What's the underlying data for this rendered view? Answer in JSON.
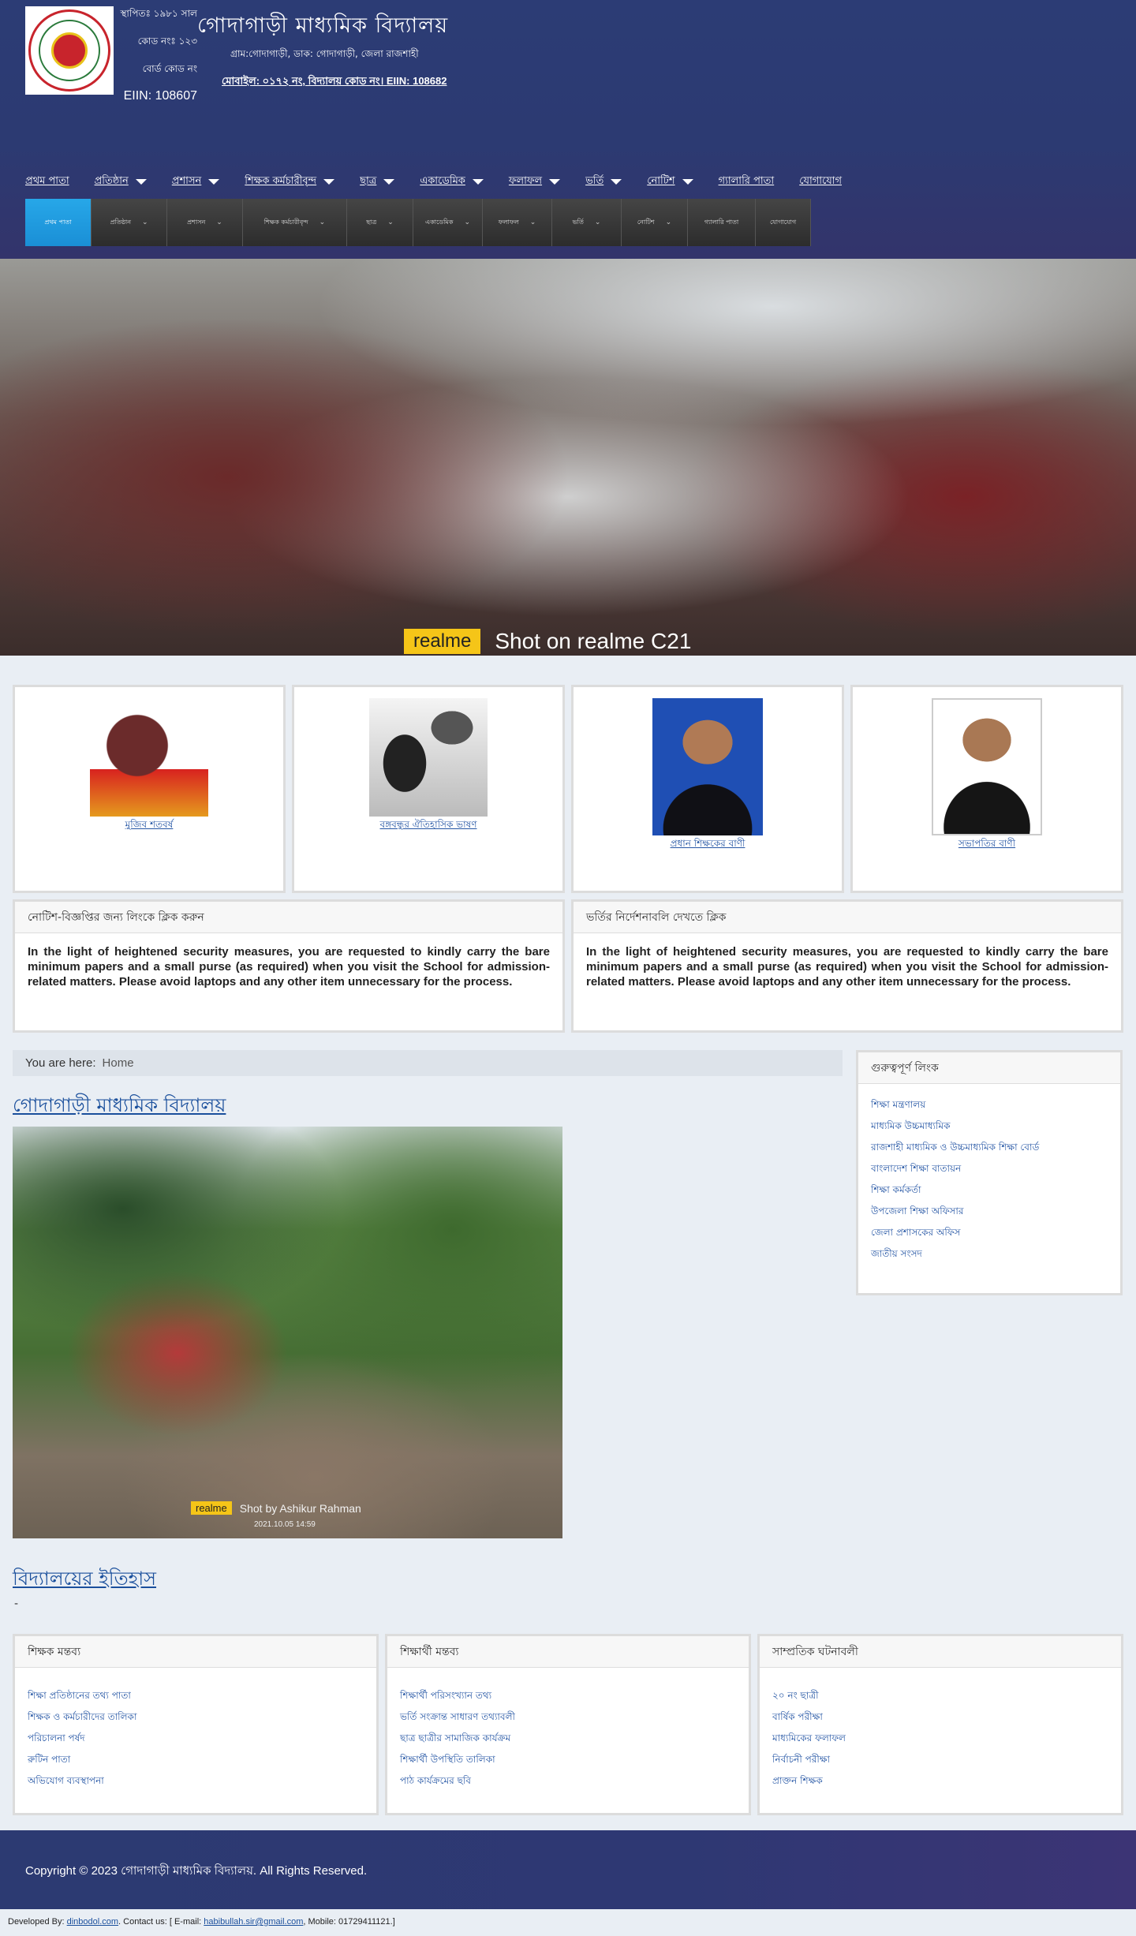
{
  "header": {
    "meta_lines": [
      "স্থাপিতঃ ১৯৮১ সাল",
      "কোড নংঃ ১২৩",
      "বোর্ড কোড নং"
    ],
    "eiin_short": "EIIN: 108607",
    "title": "গোদাগাড়ী মাধ্যমিক বিদ্যালয়",
    "address": "গ্রাম:গোদাগাড়ী, ডাক: গোদাগাড়ী, জেলা রাজশাহী",
    "contact": "মোবাইল: ০১৭২ নং, বিদ্যালয় কোড নং।",
    "contact_eiin": "EIIN: 108682"
  },
  "topnav": [
    {
      "label": "প্রথম পাতা",
      "caret": false,
      "active": true
    },
    {
      "label": "প্রতিষ্ঠান",
      "caret": true
    },
    {
      "label": "প্রশাসন",
      "caret": true
    },
    {
      "label": "শিক্ষক কর্মচারীবৃন্দ",
      "caret": true
    },
    {
      "label": "ছাত্র",
      "caret": true
    },
    {
      "label": "একাডেমিক",
      "caret": true
    },
    {
      "label": "ফলাফল",
      "caret": true
    },
    {
      "label": "ভর্তি",
      "caret": true
    },
    {
      "label": "নোটিশ",
      "caret": true
    },
    {
      "label": "গ্যালারি পাতা",
      "caret": false
    },
    {
      "label": "যোগাযোগ",
      "caret": false
    }
  ],
  "subnav": [
    {
      "label": "প্রথম পাতা",
      "chev": false,
      "active": true
    },
    {
      "label": "প্রতিষ্ঠান",
      "chev": true
    },
    {
      "label": "প্রশাসন",
      "chev": true
    },
    {
      "label": "শিক্ষক কর্মচারীবৃন্দ",
      "chev": true
    },
    {
      "label": "ছাত্র",
      "chev": true
    },
    {
      "label": "একাডেমিক",
      "chev": true
    },
    {
      "label": "ফলাফল",
      "chev": true
    },
    {
      "label": "ভর্তি",
      "chev": true
    },
    {
      "label": "নোটিশ",
      "chev": true
    },
    {
      "label": "গ্যালারি পাতা",
      "chev": false
    },
    {
      "label": "যোগাযোগ",
      "chev": false
    }
  ],
  "hero": {
    "watermark_badge": "realme",
    "watermark_text": "Shot on realme C21"
  },
  "cards": [
    {
      "caption": "মুজিব শতবর্ষ",
      "kind": "bb"
    },
    {
      "caption": "বঙ্গবন্ধুর ঐতিহাসিক ভাষণ",
      "kind": "bw"
    },
    {
      "caption": "প্রধান শিক্ষকের বাণী",
      "kind": "p1"
    },
    {
      "caption": "সভাপতির বাণী",
      "kind": "p2"
    }
  ],
  "notices": [
    {
      "title": "নোটিশ-বিজ্ঞপ্তির জন্য লিংকে ক্লিক করুন",
      "body": "In the light of heightened security measures, you are requested to kindly carry the bare minimum papers and a small purse (as required) when you visit the School for admission- related matters. Please avoid laptops and any other item unnecessary for the process."
    },
    {
      "title": "ভর্তির নির্দেশনাবলি দেখতে ক্লিক",
      "body": "In the light of heightened security measures, you are requested to kindly carry the bare minimum papers and a small purse (as required) when you visit the School for admission- related matters. Please avoid laptops and any other item unnecessary for the process."
    }
  ],
  "breadcrumb": {
    "prefix": "You are here:",
    "home": "Home"
  },
  "article": {
    "title": "গোদাগাড়ী মাধ্যমিক বিদ্যালয়",
    "image_watermark_badge": "realme",
    "image_watermark_text": "Shot by Ashikur Rahman",
    "image_timestamp": "2021.10.05 14:59"
  },
  "article2": {
    "title": "বিদ্যালয়ের ইতিহাস",
    "body": "-"
  },
  "sidebar": {
    "title": "গুরুত্বপূর্ণ লিংক",
    "links": [
      "শিক্ষা মন্ত্রণালয়",
      "মাধ্যমিক উচ্চমাধ্যমিক",
      "রাজশাহী মাধ্যমিক ও উচ্চমাধ্যমিক শিক্ষা বোর্ড",
      "বাংলাদেশ শিক্ষা বাতায়ন",
      "শিক্ষা কর্মকর্তা",
      "উপজেলা শিক্ষা অফিসার",
      "জেলা প্রশাসকের অফিস",
      "জাতীয় সংসদ"
    ]
  },
  "modules": [
    {
      "title": "শিক্ষক মন্তব্য",
      "links": [
        "শিক্ষা প্রতিষ্ঠানের তথ্য পাতা",
        "শিক্ষক ও কর্মচারীদের তালিকা",
        "পরিচালনা পর্ষদ",
        "রুটিন পাতা",
        "অভিযোগ ব্যবস্থাপনা"
      ]
    },
    {
      "title": "শিক্ষার্থী মন্তব্য",
      "links": [
        "শিক্ষার্থী পরিসংখ্যান তথ্য",
        "ভর্তি সংক্রান্ত সাধারণ তথ্যাবলী",
        "ছাত্র ছাত্রীর সামাজিক কার্যক্রম",
        "শিক্ষার্থী উপস্থিতি তালিকা",
        "পাঠ কার্যক্রমের ছবি"
      ]
    },
    {
      "title": "সাম্প্রতিক ঘটনাবলী",
      "links": [
        "২০ নং ছাত্রী",
        "বার্ষিক পরীক্ষা",
        "মাধ্যমিকের ফলাফল",
        "নির্বাচনী পরীক্ষা",
        "প্রাক্তন শিক্ষক"
      ]
    }
  ],
  "footer": {
    "copyright": "Copyright © 2023 গোদাগাড়ী মাধ্যমিক বিদ্যালয়. All Rights Reserved.",
    "dev_prefix": "Developed By:",
    "dev_link": "dinbodol.com",
    "contact_prefix": ". Contact us: [ E-mail:",
    "email": "habibullah.sir@gmail.com",
    "mobile": ", Mobile: 01729411121.]"
  },
  "colors": {
    "header_bg": "#2c3c75",
    "active_subnav": "#1a8fd6",
    "link": "#2455a4"
  }
}
